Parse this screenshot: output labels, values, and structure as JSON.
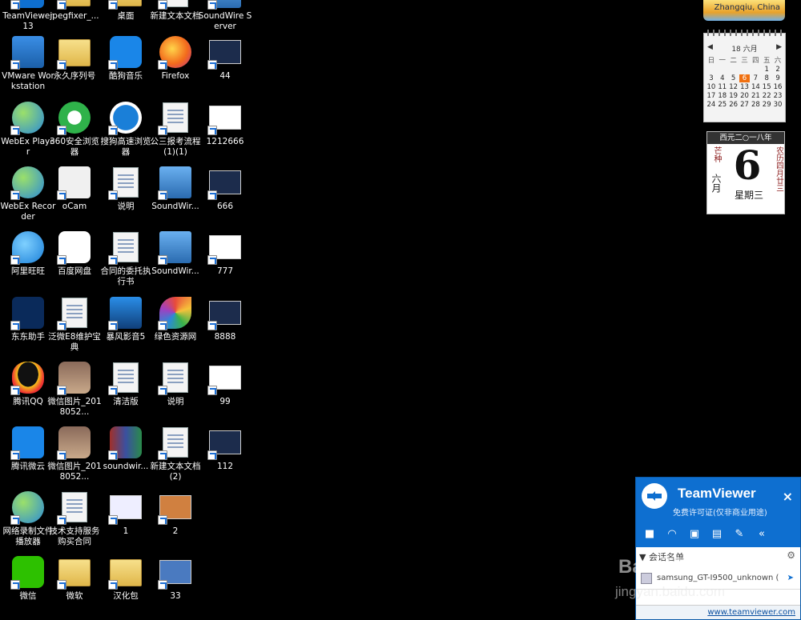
{
  "desktop": {
    "icons": [
      {
        "label": "TeamViewer 13",
        "icon": "teamviewer-icon"
      },
      {
        "label": "jpegfixer_...",
        "icon": "folder-icon"
      },
      {
        "label": "桌面",
        "icon": "folder-icon"
      },
      {
        "label": "新建文本文档",
        "icon": "text-document-icon"
      },
      {
        "label": "SoundWire Server",
        "icon": "soundwire-icon"
      },
      {
        "label": "VMware Workstation",
        "icon": "vmware-icon"
      },
      {
        "label": "永久序列号",
        "icon": "folder-icon"
      },
      {
        "label": "酷狗音乐",
        "icon": "kugou-music-icon"
      },
      {
        "label": "Firefox",
        "icon": "firefox-icon"
      },
      {
        "label": "44",
        "icon": "image-thumbnail-icon"
      },
      {
        "label": "WebEx Player",
        "icon": "webex-player-icon"
      },
      {
        "label": "360安全浏览器",
        "icon": "360-browser-icon"
      },
      {
        "label": "搜狗高速浏览器",
        "icon": "sogou-browser-icon"
      },
      {
        "label": "公三报考流程(1)(1)",
        "icon": "word-document-icon"
      },
      {
        "label": "1212666",
        "icon": "image-thumbnail-icon"
      },
      {
        "label": "WebEx Recorder",
        "icon": "webex-recorder-icon"
      },
      {
        "label": "oCam",
        "icon": "ocam-icon"
      },
      {
        "label": "说明",
        "icon": "word-document-icon"
      },
      {
        "label": "SoundWir...",
        "icon": "soundwire-icon"
      },
      {
        "label": "666",
        "icon": "image-thumbnail-icon"
      },
      {
        "label": "阿里旺旺",
        "icon": "aliwangwang-icon"
      },
      {
        "label": "百度网盘",
        "icon": "baidu-netdisk-icon"
      },
      {
        "label": "合同的委托执行书",
        "icon": "word-document-icon"
      },
      {
        "label": "SoundWir...",
        "icon": "soundwire-icon"
      },
      {
        "label": "777",
        "icon": "image-thumbnail-icon"
      },
      {
        "label": "东东助手",
        "icon": "dongdong-icon"
      },
      {
        "label": "泛微E8维护宝典",
        "icon": "word-document-icon"
      },
      {
        "label": "暴风影音5",
        "icon": "baofeng-icon"
      },
      {
        "label": "绿色资源网",
        "icon": "green-resource-icon"
      },
      {
        "label": "8888",
        "icon": "image-thumbnail-icon"
      },
      {
        "label": "腾讯QQ",
        "icon": "qq-icon"
      },
      {
        "label": "微信图片_2018052...",
        "icon": "photo-icon"
      },
      {
        "label": "清洁版",
        "icon": "pdf-document-icon"
      },
      {
        "label": "说明",
        "icon": "text-document-icon"
      },
      {
        "label": "99",
        "icon": "image-thumbnail-icon"
      },
      {
        "label": "腾讯微云",
        "icon": "weiyun-icon"
      },
      {
        "label": "微信图片_2018052...",
        "icon": "photo-icon"
      },
      {
        "label": "soundwir...",
        "icon": "winrar-icon"
      },
      {
        "label": "新建文本文档 (2)",
        "icon": "text-document-icon"
      },
      {
        "label": "112",
        "icon": "image-thumbnail-icon"
      },
      {
        "label": "网络录制文件播放器",
        "icon": "network-player-icon"
      },
      {
        "label": "技术支持服务购买合同",
        "icon": "word-document-icon"
      },
      {
        "label": "1",
        "icon": "image-thumbnail-icon"
      },
      {
        "label": "2",
        "icon": "image-thumbnail-icon"
      },
      {
        "label": "微信",
        "icon": "wechat-icon"
      },
      {
        "label": "微软",
        "icon": "folder-icon"
      },
      {
        "label": "汉化包",
        "icon": "folder-icon"
      },
      {
        "label": "33",
        "icon": "image-thumbnail-icon"
      }
    ]
  },
  "gadgets": {
    "weather": {
      "location": "Zhangqiu, China"
    },
    "calendar": {
      "header": "18 六月",
      "weekdays": [
        "日",
        "一",
        "二",
        "三",
        "四",
        "五",
        "六"
      ],
      "weeks": [
        [
          "",
          "",
          "",
          "",
          "",
          "1",
          "2"
        ],
        [
          "3",
          "4",
          "5",
          "6",
          "7",
          "8",
          "9"
        ],
        [
          "10",
          "11",
          "12",
          "13",
          "14",
          "15",
          "16"
        ],
        [
          "17",
          "18",
          "19",
          "20",
          "21",
          "22",
          "23"
        ],
        [
          "24",
          "25",
          "26",
          "27",
          "28",
          "29",
          "30"
        ]
      ],
      "today": "6",
      "accent": "#f07010"
    },
    "lunar": {
      "year_banner": "西元二○一八年",
      "solar_term": "芒种",
      "month": "六月",
      "day": "6",
      "weekday": "星期三",
      "lunar_date": "农历四月廿三"
    }
  },
  "teamviewer": {
    "title": "TeamViewer",
    "license": "免费许可证(仅非商业用途)",
    "close": "×",
    "section": "会话名单",
    "device": "samsung_GT-I9500_unknown (",
    "footer_link": "www.teamviewer.com",
    "brand_color": "#0e6fd0"
  },
  "watermark": {
    "text": "Bai 经验",
    "url": "jingyan.baidu.com"
  }
}
